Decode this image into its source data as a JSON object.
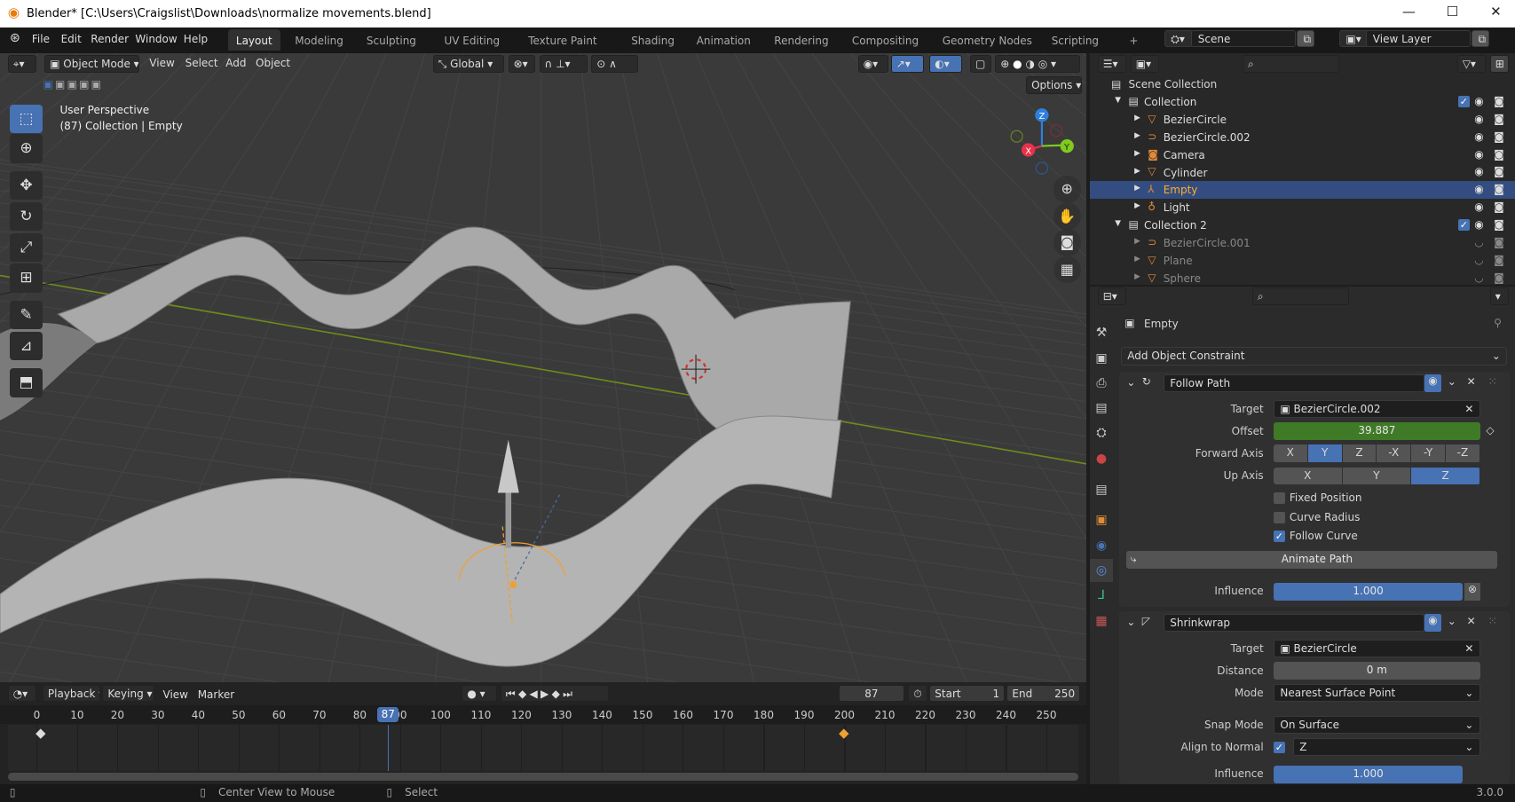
{
  "window": {
    "title": "Blender* [C:\\Users\\Craigslist\\Downloads\\normalize movements.blend]",
    "controls": [
      "—",
      "☐",
      "✕"
    ]
  },
  "menu": [
    "File",
    "Edit",
    "Render",
    "Window",
    "Help"
  ],
  "workspaces": [
    {
      "label": "Layout",
      "active": true
    },
    {
      "label": "Modeling"
    },
    {
      "label": "Sculpting"
    },
    {
      "label": "UV Editing"
    },
    {
      "label": "Texture Paint"
    },
    {
      "label": "Shading"
    },
    {
      "label": "Animation"
    },
    {
      "label": "Rendering"
    },
    {
      "label": "Compositing"
    },
    {
      "label": "Geometry Nodes"
    },
    {
      "label": "Scripting"
    },
    {
      "label": "+"
    }
  ],
  "scene": {
    "label": "Scene",
    "view_layer": "View Layer"
  },
  "viewport": {
    "mode": "Object Mode",
    "menus": [
      "View",
      "Select",
      "Add",
      "Object"
    ],
    "orientation": "Global",
    "options": "Options",
    "info_line1": "User Perspective",
    "info_line2": "(87) Collection | Empty",
    "gizmo": {
      "x": "X",
      "y": "Y",
      "z": "Z"
    },
    "colors": {
      "x": "#e8324a",
      "y": "#7fcc1c",
      "z": "#2f7fe0",
      "object_selected": "#f0a030"
    }
  },
  "timeline": {
    "menus": [
      "Playback",
      "Keying",
      "View",
      "Marker"
    ],
    "current_frame": "87",
    "start_label": "Start",
    "start": "1",
    "end_label": "End",
    "end": "250",
    "ticks": [
      "0",
      "10",
      "20",
      "30",
      "40",
      "50",
      "60",
      "70",
      "80",
      "90",
      "100",
      "110",
      "120",
      "130",
      "140",
      "150",
      "160",
      "170",
      "180",
      "190",
      "200",
      "210",
      "220",
      "230",
      "240",
      "250"
    ],
    "keyframes": [
      1,
      200
    ]
  },
  "status": {
    "center_view": "Center View to Mouse",
    "select": "Select",
    "version": "3.0.0"
  },
  "outliner": {
    "root": "Scene Collection",
    "rows": [
      {
        "label": "Collection",
        "depth": 0,
        "type": "collection",
        "expanded": true
      },
      {
        "label": "BezierCircle",
        "depth": 1,
        "type": "mesh"
      },
      {
        "label": "BezierCircle.002",
        "depth": 1,
        "type": "curve"
      },
      {
        "label": "Camera",
        "depth": 1,
        "type": "camera"
      },
      {
        "label": "Cylinder",
        "depth": 1,
        "type": "mesh"
      },
      {
        "label": "Empty",
        "depth": 1,
        "type": "empty",
        "selected": true
      },
      {
        "label": "Light",
        "depth": 1,
        "type": "light"
      },
      {
        "label": "Collection 2",
        "depth": 0,
        "type": "collection",
        "expanded": true
      },
      {
        "label": "BezierCircle.001",
        "depth": 1,
        "type": "curve",
        "hidden": true
      },
      {
        "label": "Plane",
        "depth": 1,
        "type": "mesh",
        "hidden": true
      },
      {
        "label": "Sphere",
        "depth": 1,
        "type": "mesh",
        "hidden": true
      }
    ]
  },
  "properties": {
    "object_name": "Empty",
    "add_constraint": "Add Object Constraint",
    "follow_path": {
      "name": "Follow Path",
      "target_label": "Target",
      "target": "BezierCircle.002",
      "offset_label": "Offset",
      "offset": "39.887",
      "forward_axis_label": "Forward Axis",
      "forward_axis": [
        "X",
        "Y",
        "Z",
        "-X",
        "-Y",
        "-Z"
      ],
      "forward_selected": "Y",
      "up_axis_label": "Up Axis",
      "up_axis": [
        "X",
        "Y",
        "Z"
      ],
      "up_selected": "Z",
      "fixed_position": "Fixed Position",
      "fixed_position_checked": false,
      "curve_radius": "Curve Radius",
      "curve_radius_checked": false,
      "follow_curve": "Follow Curve",
      "follow_curve_checked": true,
      "animate_path": "Animate Path",
      "influence_label": "Influence",
      "influence": "1.000"
    },
    "shrinkwrap": {
      "name": "Shrinkwrap",
      "target_label": "Target",
      "target": "BezierCircle",
      "distance_label": "Distance",
      "distance": "0 m",
      "mode_label": "Mode",
      "mode": "Nearest Surface Point",
      "snap_mode_label": "Snap Mode",
      "snap_mode": "On Surface",
      "align_label": "Align to Normal",
      "align_checked": true,
      "align_axis": "Z",
      "influence_label": "Influence",
      "influence": "1.000"
    }
  }
}
